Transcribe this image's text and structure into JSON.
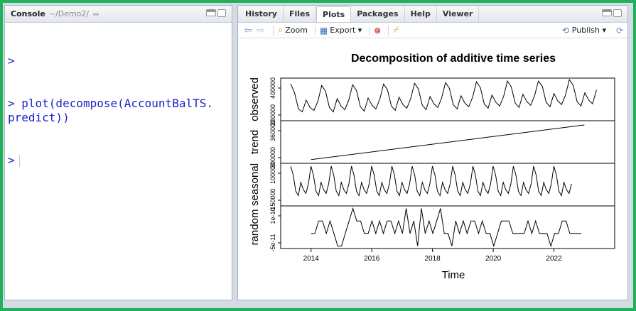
{
  "console": {
    "title": "Console",
    "path": "~/Demo2/",
    "lines": [
      ">",
      "> plot(decompose(AccountBalTS.\npredict))",
      ">"
    ]
  },
  "tabs": [
    "History",
    "Files",
    "Plots",
    "Packages",
    "Help",
    "Viewer"
  ],
  "active_tab": "Plots",
  "toolbar": {
    "zoom_label": "Zoom",
    "export_label": "Export ▾",
    "publish_label": "Publish ▾"
  },
  "colors": {
    "frame": "#1fb25a",
    "console_text": "#1b21c9"
  },
  "chart_data": {
    "type": "line",
    "title": "Decomposition of additive time series",
    "xlabel": "Time",
    "x_ticks": [
      "2014",
      "2016",
      "2018",
      "2020",
      "2022"
    ],
    "xlim": [
      2013.0,
      2024.0
    ],
    "panels": [
      {
        "ylabel": "observed",
        "ticks": [
          "200000",
          "400000"
        ],
        "ylim": [
          150000,
          440000
        ],
        "values": [
          400000,
          340000,
          230000,
          210000,
          290000,
          240000,
          220000,
          280000,
          390000,
          350000,
          240000,
          210000,
          300000,
          250000,
          225000,
          290000,
          395000,
          355000,
          245000,
          215000,
          305000,
          255000,
          230000,
          295000,
          400000,
          360000,
          250000,
          220000,
          310000,
          260000,
          235000,
          300000,
          405000,
          365000,
          255000,
          225000,
          315000,
          265000,
          240000,
          305000,
          410000,
          370000,
          260000,
          230000,
          320000,
          270000,
          245000,
          310000,
          415000,
          375000,
          265000,
          235000,
          325000,
          275000,
          250000,
          315000,
          420000,
          380000,
          270000,
          240000,
          330000,
          280000,
          255000,
          320000,
          420000,
          385000,
          275000,
          245000,
          335000,
          285000,
          260000,
          325000,
          430000,
          390000,
          280000,
          250000,
          340000,
          290000,
          265000,
          360000
        ]
      },
      {
        "ylabel": "trend",
        "ticks": [
          "300000",
          "360000"
        ],
        "ylim": [
          290000,
          370000
        ],
        "values": [
          297000,
          362000
        ]
      },
      {
        "ylabel": "seasonal",
        "ticks": [
          "-150000",
          "100000"
        ],
        "ylim": [
          -160000,
          130000
        ],
        "values": [
          110000,
          50000,
          -60000,
          -90000,
          0,
          -50000,
          -75000,
          -10000
        ]
      },
      {
        "ylabel": "random",
        "ticks": [
          "-5e-11",
          "1e-10"
        ],
        "ylim": [
          -6e-11,
          1.1e-10
        ],
        "values": [
          0,
          0,
          5e-11,
          5e-11,
          0,
          5e-11,
          0,
          -5e-11,
          -5e-11,
          0,
          5e-11,
          1e-10,
          5e-11,
          5e-11,
          0,
          0,
          5e-11,
          0,
          5e-11,
          0,
          5e-11,
          5e-11,
          0,
          5e-11,
          0,
          1e-10,
          0,
          5e-11,
          -5e-11,
          1e-10,
          0,
          5e-11,
          0,
          5e-11,
          1e-10,
          0,
          0,
          -5e-11,
          5e-11,
          0,
          5e-11,
          0,
          5e-11,
          5e-11,
          0,
          5e-11,
          0,
          0,
          -5e-11,
          0,
          5e-11,
          5e-11,
          5e-11,
          0,
          0,
          0,
          0,
          5e-11,
          0,
          5e-11,
          0,
          0,
          0,
          -5e-11,
          0,
          0,
          5e-11,
          5e-11,
          0,
          0,
          0,
          0
        ]
      }
    ]
  }
}
